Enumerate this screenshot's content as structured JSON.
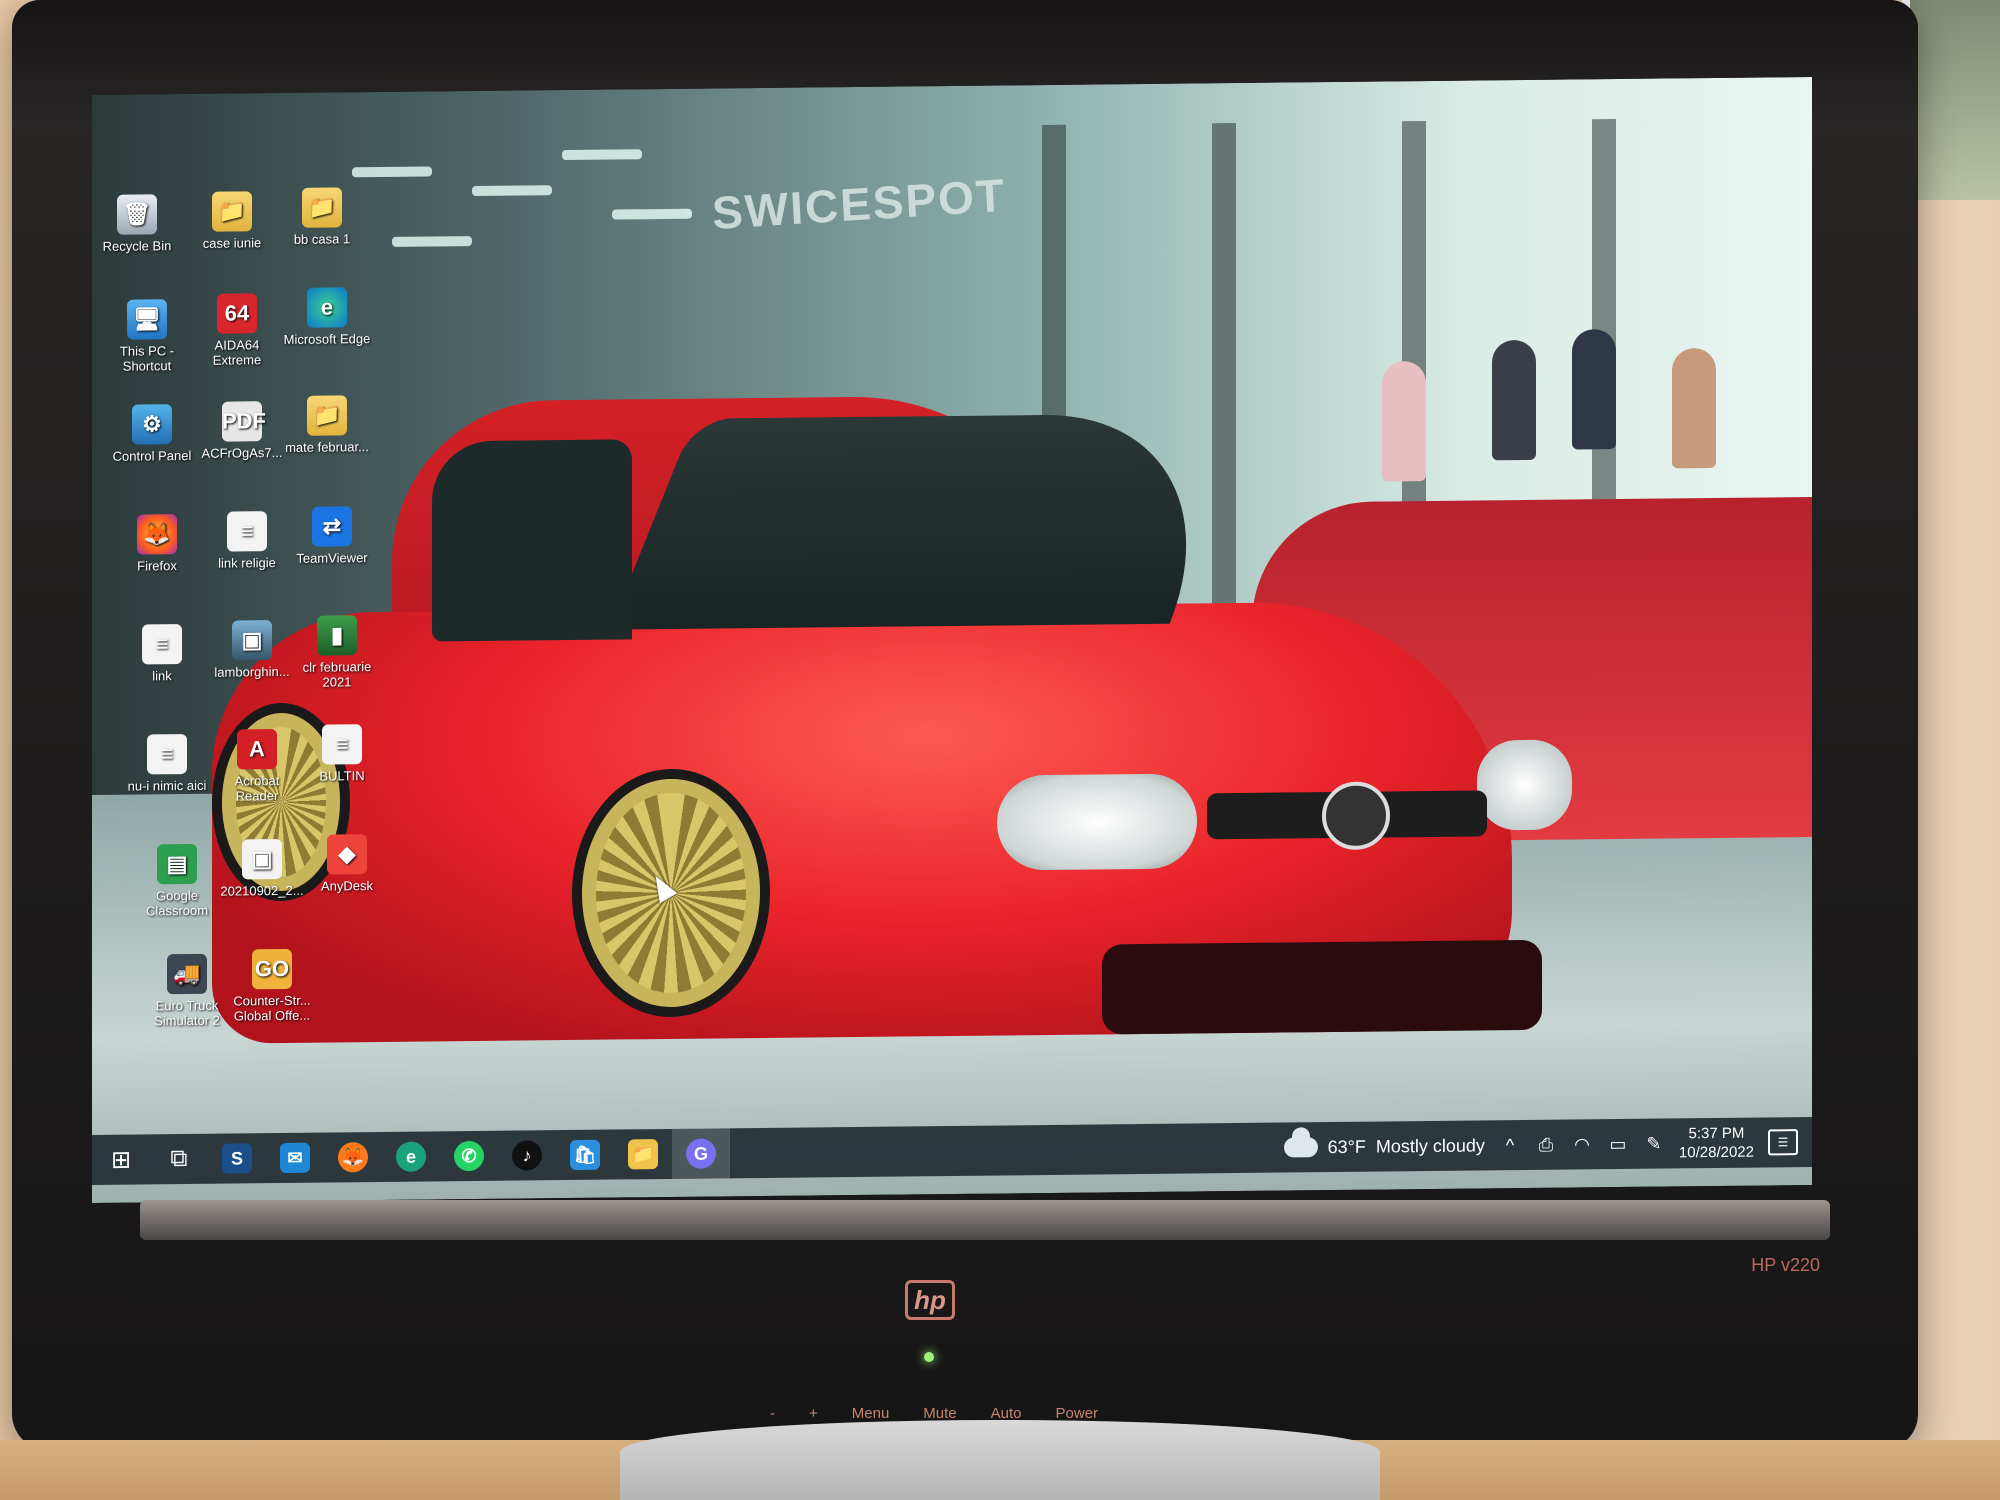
{
  "desktop": {
    "icons": [
      {
        "label": "Recycle Bin",
        "glyph": "🗑"
      },
      {
        "label": "case iunie",
        "glyph": "📁"
      },
      {
        "label": "bb casa 1",
        "glyph": "📁"
      },
      {
        "label": "This PC - Shortcut",
        "glyph": "🖥"
      },
      {
        "label": "AIDA64 Extreme",
        "glyph": "64"
      },
      {
        "label": "Microsoft Edge",
        "glyph": "e"
      },
      {
        "label": "Control Panel",
        "glyph": "⚙"
      },
      {
        "label": "ACFrOgAs7...",
        "glyph": "PDF"
      },
      {
        "label": "mate februar...",
        "glyph": "📁"
      },
      {
        "label": "Firefox",
        "glyph": "🦊"
      },
      {
        "label": "link religie",
        "glyph": "≡"
      },
      {
        "label": "TeamViewer",
        "glyph": "⇄"
      },
      {
        "label": "link",
        "glyph": "≡"
      },
      {
        "label": "lamborghin...",
        "glyph": "▣"
      },
      {
        "label": "clr februarie 2021",
        "glyph": "▮"
      },
      {
        "label": "nu-i nimic aici",
        "glyph": "≡"
      },
      {
        "label": "Acrobat Reader",
        "glyph": "A"
      },
      {
        "label": "BULTIN",
        "glyph": "≡"
      },
      {
        "label": "Google Classroom",
        "glyph": "▤"
      },
      {
        "label": "20210902_2...",
        "glyph": "▣"
      },
      {
        "label": "AnyDesk",
        "glyph": "◆"
      },
      {
        "label": "Euro Truck Simulator 2",
        "glyph": "🚚"
      },
      {
        "label": "Counter-Str... Global Offe...",
        "glyph": "GO"
      }
    ]
  },
  "wallpaper": {
    "sign_text": "SWICESPOT"
  },
  "taskbar": {
    "start_glyph": "⊞",
    "task_view_glyph": "⧉",
    "apps": [
      {
        "name": "steam",
        "glyph": "S",
        "color": "#1a4f8a"
      },
      {
        "name": "mail",
        "glyph": "✉",
        "color": "#1e88d6"
      },
      {
        "name": "firefox",
        "glyph": "🦊",
        "color": "#ff7a1a"
      },
      {
        "name": "edge",
        "glyph": "e",
        "color": "#1aa37a"
      },
      {
        "name": "whatsapp",
        "glyph": "✆",
        "color": "#25d366"
      },
      {
        "name": "tiktok",
        "glyph": "♪",
        "color": "#111111"
      },
      {
        "name": "microsoft-store",
        "glyph": "🛍",
        "color": "#2b8fe0"
      },
      {
        "name": "file-explorer",
        "glyph": "📁",
        "color": "#f1c24c"
      },
      {
        "name": "google-meet",
        "glyph": "G",
        "color": "#7a6ff0"
      }
    ],
    "weather": {
      "temperature": "63°F",
      "condition": "Mostly cloudy"
    },
    "tray": {
      "chevron": "^",
      "meet": "⎙",
      "network": "◠",
      "battery": "▭",
      "pen": "✎"
    },
    "clock": {
      "time": "5:37 PM",
      "date": "10/28/2022"
    },
    "notification_glyph": "☰"
  },
  "monitor": {
    "brand": "hp",
    "model": "HP v220",
    "controls": [
      "-",
      "+",
      "Menu",
      "Mute",
      "Auto",
      "Power"
    ]
  }
}
